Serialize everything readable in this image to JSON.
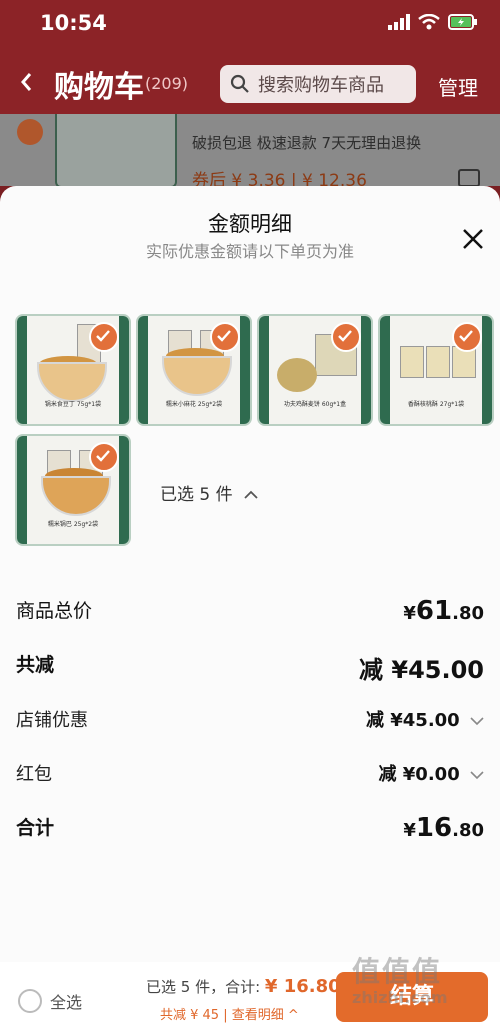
{
  "status": {
    "time": "10:54"
  },
  "nav": {
    "title": "购物车",
    "count": "(209)",
    "search_placeholder": "搜索购物车商品",
    "manage": "管理"
  },
  "background_item": {
    "tags": "破损包退   极速退款   7天无理由退换",
    "price_line": "券后 ¥ 3.36 | ¥ 12.36"
  },
  "sheet": {
    "title": "金额明细",
    "subtitle": "实际优惠金额请以下单页为准",
    "products": [
      {
        "caption": "锅米食豆丁 75g*1袋"
      },
      {
        "caption": "糯米小麻花 25g*2袋"
      },
      {
        "caption": "功夫鸡酥麦饼 60g*1盒"
      },
      {
        "caption": "香酥核桃酥 27g*1袋"
      },
      {
        "caption": "糯米锅巴 25g*2袋"
      }
    ],
    "selected": "已选 5 件"
  },
  "breakdown": {
    "goods_total": {
      "label": "商品总价",
      "symbol": "¥",
      "int": "61",
      "cents": ".80"
    },
    "discount": {
      "label": "共减",
      "value": "减 ¥45.00"
    },
    "shop_coupon": {
      "label": "店铺优惠",
      "value": "减 ¥45.00"
    },
    "red_packet": {
      "label": "红包",
      "value": "减 ¥0.00"
    },
    "total": {
      "label": "合计",
      "symbol": "¥",
      "int": "16",
      "cents": ".80"
    }
  },
  "footer": {
    "select_all": "全选",
    "summary_prefix": "已选 5 件，合计: ",
    "summary_total": "¥ 16.80",
    "discount_line": "共减 ¥ 45 | 查看明细 ^",
    "checkout": "结算"
  },
  "watermark": {
    "text": "值值值",
    "url": "zhizhi.com"
  },
  "colors": {
    "accent": "#e0672b",
    "brand_red": "#8c2327"
  }
}
